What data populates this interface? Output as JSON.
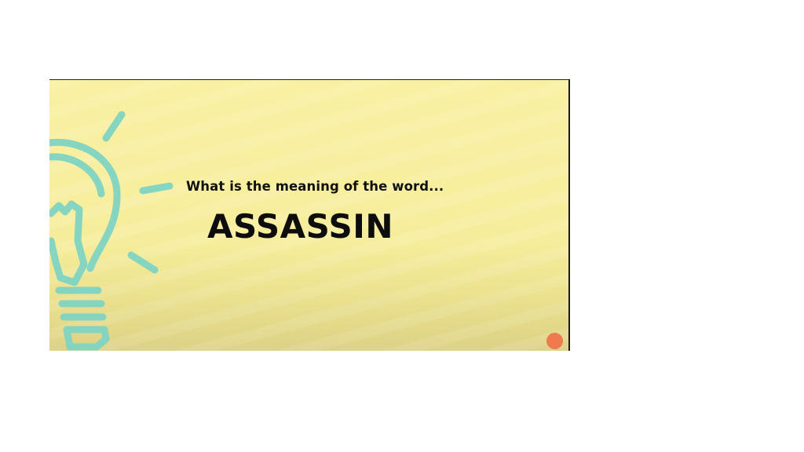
{
  "slide": {
    "question": "What is the meaning of the word...",
    "word": "ASSASSIN"
  },
  "icons": {
    "bulb": "lightbulb-icon",
    "logo": "logo-badge"
  },
  "colors": {
    "slide_background": "#f9f0a2",
    "bulb_stroke": "#7fd3c2",
    "text": "#111111",
    "logo": "#ee7a4e"
  }
}
